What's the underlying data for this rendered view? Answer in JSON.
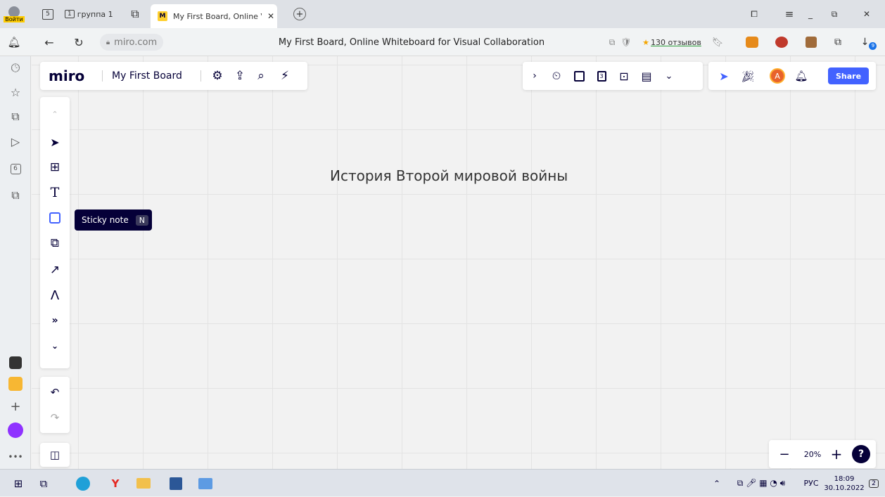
{
  "browser": {
    "login_label": "Войти",
    "tab_group_label": "группа 1",
    "tab_group_count": "1",
    "tab_group_num": "5",
    "active_tab_title": "My First Board, Online V",
    "address_url": "miro.com",
    "page_title": "My First Board, Online Whiteboard for Visual Collaboration",
    "reviews_label": "130 отзывов",
    "downloads_badge": "9",
    "sidebar_badge": "6"
  },
  "miro": {
    "logo": "miro",
    "board_name": "My First Board",
    "share_label": "Share",
    "avatar_initial": "A",
    "tooltip_label": "Sticky note",
    "tooltip_key": "N",
    "board_text": "История Второй мировой войны",
    "zoom": "20%",
    "help": "?"
  },
  "taskbar": {
    "lang": "РУС",
    "time": "18:09",
    "date": "30.10.2022",
    "notif_count": "2"
  },
  "colors": {
    "share": "#4262ff",
    "avatar": "#e8622b",
    "miro_yellow": "#ffd02f"
  }
}
